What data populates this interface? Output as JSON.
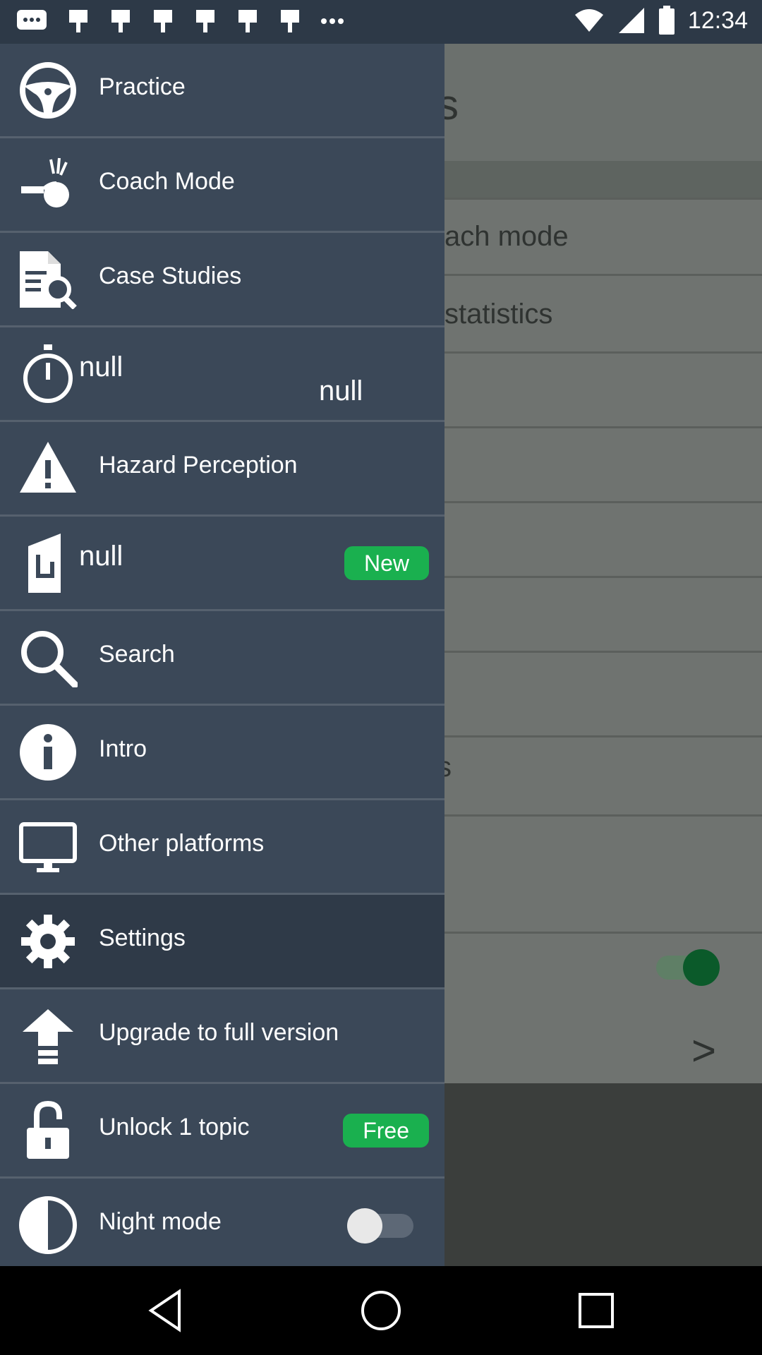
{
  "status_bar": {
    "time": "12:34",
    "icons": [
      "messages-icon",
      "notification-icon",
      "notification-icon",
      "notification-icon",
      "notification-icon",
      "notification-icon",
      "notification-icon",
      "more-dots-icon",
      "wifi-icon",
      "signal-icon",
      "battery-icon"
    ]
  },
  "background": {
    "row_partial_1": "s",
    "row_partial_2": "ach mode",
    "row_partial_3": "statistics",
    "row_partial_4": "s",
    "toggle_on": true,
    "chevron": ">"
  },
  "drawer": {
    "items": [
      {
        "label": "Practice",
        "icon": "steering-wheel-icon"
      },
      {
        "label": "Coach Mode",
        "icon": "coach-whistle-icon"
      },
      {
        "label": "Case Studies",
        "icon": "document-search-icon"
      },
      {
        "label": "null",
        "label2": "null",
        "icon": "stopwatch-icon"
      },
      {
        "label": "Hazard Perception",
        "icon": "warning-icon"
      },
      {
        "label": "null",
        "badge": "New",
        "icon": "road-sign-icon"
      },
      {
        "label": "Search",
        "icon": "search-icon"
      },
      {
        "label": "Intro",
        "icon": "info-icon"
      },
      {
        "label": "Other platforms",
        "icon": "monitor-icon"
      },
      {
        "label": "Settings",
        "icon": "gear-icon",
        "active": true
      },
      {
        "label": "Upgrade to full version",
        "icon": "arrow-up-icon"
      },
      {
        "label": "Unlock 1 topic",
        "badge": "Free",
        "icon": "unlock-icon"
      },
      {
        "label": "Night mode",
        "icon": "half-circle-icon",
        "toggle_on": false
      }
    ]
  },
  "colors": {
    "drawer_bg": "#3b4858",
    "drawer_active": "#2f3a48",
    "badge_green": "#1ab04f",
    "toggle_green": "#0b5a2a"
  }
}
